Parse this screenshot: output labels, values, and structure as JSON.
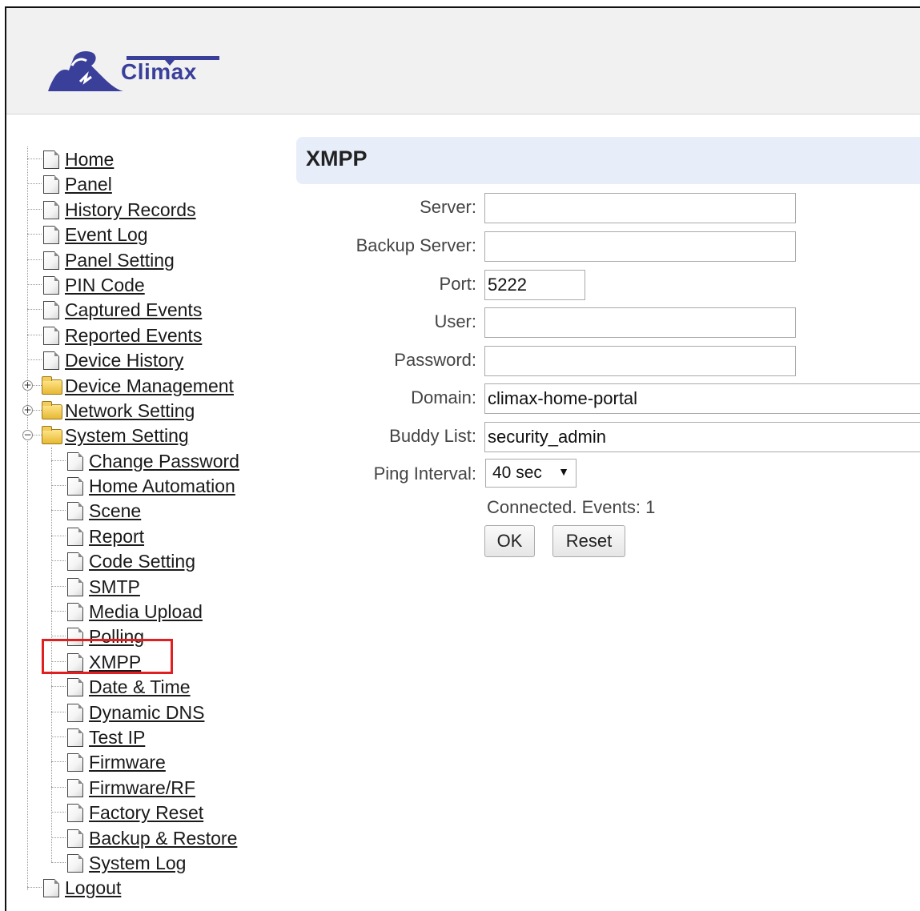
{
  "brand": {
    "name": "Climax"
  },
  "menu": {
    "top": [
      {
        "label": "Home"
      },
      {
        "label": "Panel"
      },
      {
        "label": "History Records"
      },
      {
        "label": "Event Log"
      },
      {
        "label": "Panel Setting"
      },
      {
        "label": "PIN Code"
      },
      {
        "label": "Captured Events"
      },
      {
        "label": "Reported Events"
      },
      {
        "label": "Device History"
      }
    ],
    "folders": [
      {
        "label": "Device Management",
        "state": "+"
      },
      {
        "label": "Network Setting",
        "state": "+"
      },
      {
        "label": "System Setting",
        "state": "−"
      }
    ],
    "system_setting_items": [
      {
        "label": "Change Password"
      },
      {
        "label": "Home Automation"
      },
      {
        "label": "Scene"
      },
      {
        "label": "Report"
      },
      {
        "label": "Code Setting"
      },
      {
        "label": "SMTP"
      },
      {
        "label": "Media Upload"
      },
      {
        "label": "Polling"
      },
      {
        "label": "XMPP"
      },
      {
        "label": "Date & Time"
      },
      {
        "label": "Dynamic DNS"
      },
      {
        "label": "Test IP"
      },
      {
        "label": "Firmware"
      },
      {
        "label": "Firmware/RF"
      },
      {
        "label": "Factory Reset"
      },
      {
        "label": "Backup & Restore"
      },
      {
        "label": "System Log"
      }
    ],
    "bottom": [
      {
        "label": "Logout"
      }
    ],
    "highlight_color": "#e02020"
  },
  "page": {
    "title": "XMPP",
    "fields": {
      "server": {
        "label": "Server:",
        "value": ""
      },
      "backup_server": {
        "label": "Backup Server:",
        "value": ""
      },
      "port": {
        "label": "Port:",
        "value": "5222"
      },
      "user": {
        "label": "User:",
        "value": ""
      },
      "password": {
        "label": "Password:",
        "value": ""
      },
      "domain": {
        "label": "Domain:",
        "value": "climax-home-portal"
      },
      "buddy_list": {
        "label": "Buddy List:",
        "value": "security_admin"
      },
      "ping_interval": {
        "label": "Ping Interval:",
        "value": "40 sec"
      }
    },
    "status": "Connected. Events: 1",
    "buttons": {
      "ok": "OK",
      "reset": "Reset"
    }
  }
}
